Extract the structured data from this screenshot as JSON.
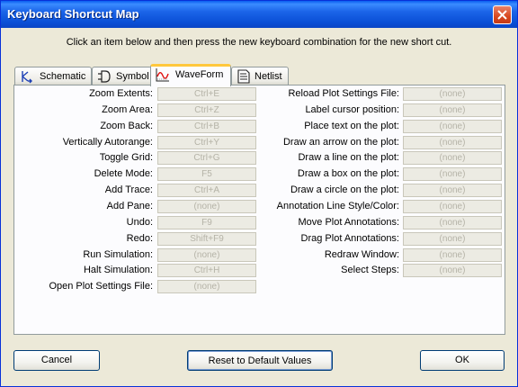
{
  "window": {
    "title": "Keyboard Shortcut Map"
  },
  "instruction": "Click an item below and then press the new keyboard combination for the new short cut.",
  "tabs": [
    {
      "label": "Schematic",
      "icon": "schematic-icon",
      "active": false
    },
    {
      "label": "Symbol",
      "icon": "symbol-icon",
      "active": false
    },
    {
      "label": "WaveForm",
      "icon": "waveform-icon",
      "active": true
    },
    {
      "label": "Netlist",
      "icon": "netlist-icon",
      "active": false
    }
  ],
  "left_shortcuts": [
    {
      "label": "Zoom Extents:",
      "key": "Ctrl+E"
    },
    {
      "label": "Zoom Area:",
      "key": "Ctrl+Z"
    },
    {
      "label": "Zoom Back:",
      "key": "Ctrl+B"
    },
    {
      "label": "Vertically Autorange:",
      "key": "Ctrl+Y"
    },
    {
      "label": "Toggle Grid:",
      "key": "Ctrl+G"
    },
    {
      "label": "Delete Mode:",
      "key": "F5"
    },
    {
      "label": "Add Trace:",
      "key": "Ctrl+A"
    },
    {
      "label": "Add Pane:",
      "key": "(none)"
    },
    {
      "label": "Undo:",
      "key": "F9"
    },
    {
      "label": "Redo:",
      "key": "Shift+F9"
    },
    {
      "label": "Run Simulation:",
      "key": "(none)"
    },
    {
      "label": "Halt Simulation:",
      "key": "Ctrl+H"
    },
    {
      "label": "Open Plot Settings File:",
      "key": "(none)"
    }
  ],
  "right_shortcuts": [
    {
      "label": "Reload Plot Settings File:",
      "key": "(none)"
    },
    {
      "label": "Label cursor position:",
      "key": "(none)"
    },
    {
      "label": "Place text on the plot:",
      "key": "(none)"
    },
    {
      "label": "Draw an arrow on the plot:",
      "key": "(none)"
    },
    {
      "label": "Draw a line on the plot:",
      "key": "(none)"
    },
    {
      "label": "Draw a box on the plot:",
      "key": "(none)"
    },
    {
      "label": "Draw a circle on the plot:",
      "key": "(none)"
    },
    {
      "label": "Annotation Line Style/Color:",
      "key": "(none)"
    },
    {
      "label": "Move Plot Annotations:",
      "key": "(none)"
    },
    {
      "label": "Drag Plot Annotations:",
      "key": "(none)"
    },
    {
      "label": "Redraw Window:",
      "key": "(none)"
    },
    {
      "label": "Select Steps:",
      "key": "(none)"
    }
  ],
  "buttons": {
    "cancel": "Cancel",
    "reset": "Reset to Default Values",
    "ok": "OK"
  },
  "colors": {
    "title_bar": "#0a5ef0",
    "active_tab_accent": "#ffc83c",
    "disabled_text": "#b5b3a7"
  }
}
